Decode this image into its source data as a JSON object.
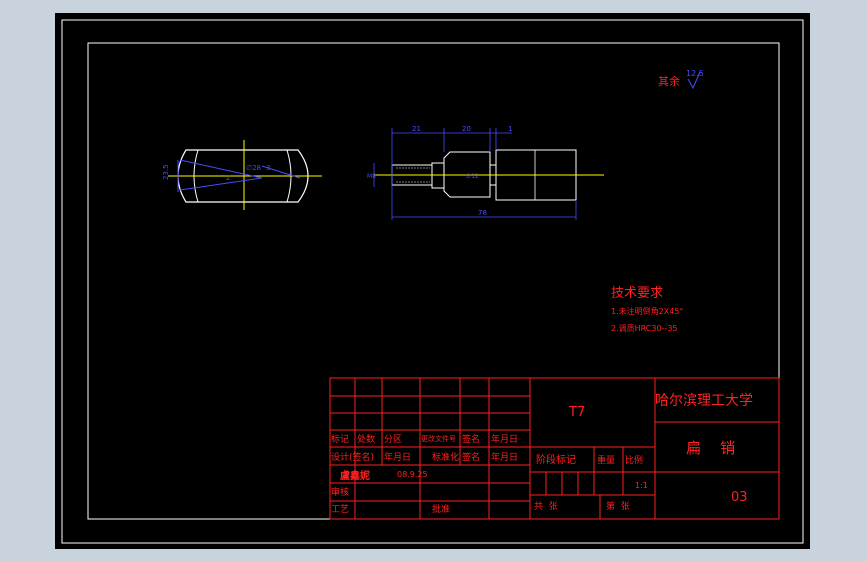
{
  "drawing": {
    "roughness_label": "其余",
    "roughness_value": "12.5",
    "tech_title": "技术要求",
    "tech_items": [
      "1.未注明倒角2X45°",
      "2.调质HRC30--35"
    ],
    "dims": {
      "d_21": "21",
      "d_20": "20",
      "d_1": "1",
      "d_78": "78",
      "d_side_left": "23.5",
      "d_side_mid": "∅28",
      "d_side_small": "3",
      "d_side_small2": "2",
      "d_shaft_left": "M8",
      "d_shaft_mid": "∅12"
    },
    "colors": {
      "background": "#000000",
      "outline": "#ffffff",
      "dim": "#4a4aff",
      "center": "#ffff00",
      "title": "#ff2020"
    }
  },
  "title_block": {
    "grade": "T7",
    "university": "哈尔滨理工大学",
    "part_name": "扁    销",
    "drawing_no": "03",
    "hdr": {
      "mark": "标记",
      "count": "处数",
      "zone": "分区",
      "doc_no": "更改文件号",
      "sign": "签名",
      "date": "年月日",
      "design": "设计(签名)",
      "date2": "年月日",
      "std": "标准化",
      "sign2": "签名",
      "date3": "年月日",
      "check": "审核",
      "process": "工艺",
      "approve": "批准",
      "stage": "阶段标记",
      "weight": "重量",
      "scale": "比例",
      "total": "共  张",
      "sheet": "第  张"
    },
    "handwritten": "盧鑫妮",
    "date_value": "08.9.25",
    "scale_value": "1:1"
  }
}
